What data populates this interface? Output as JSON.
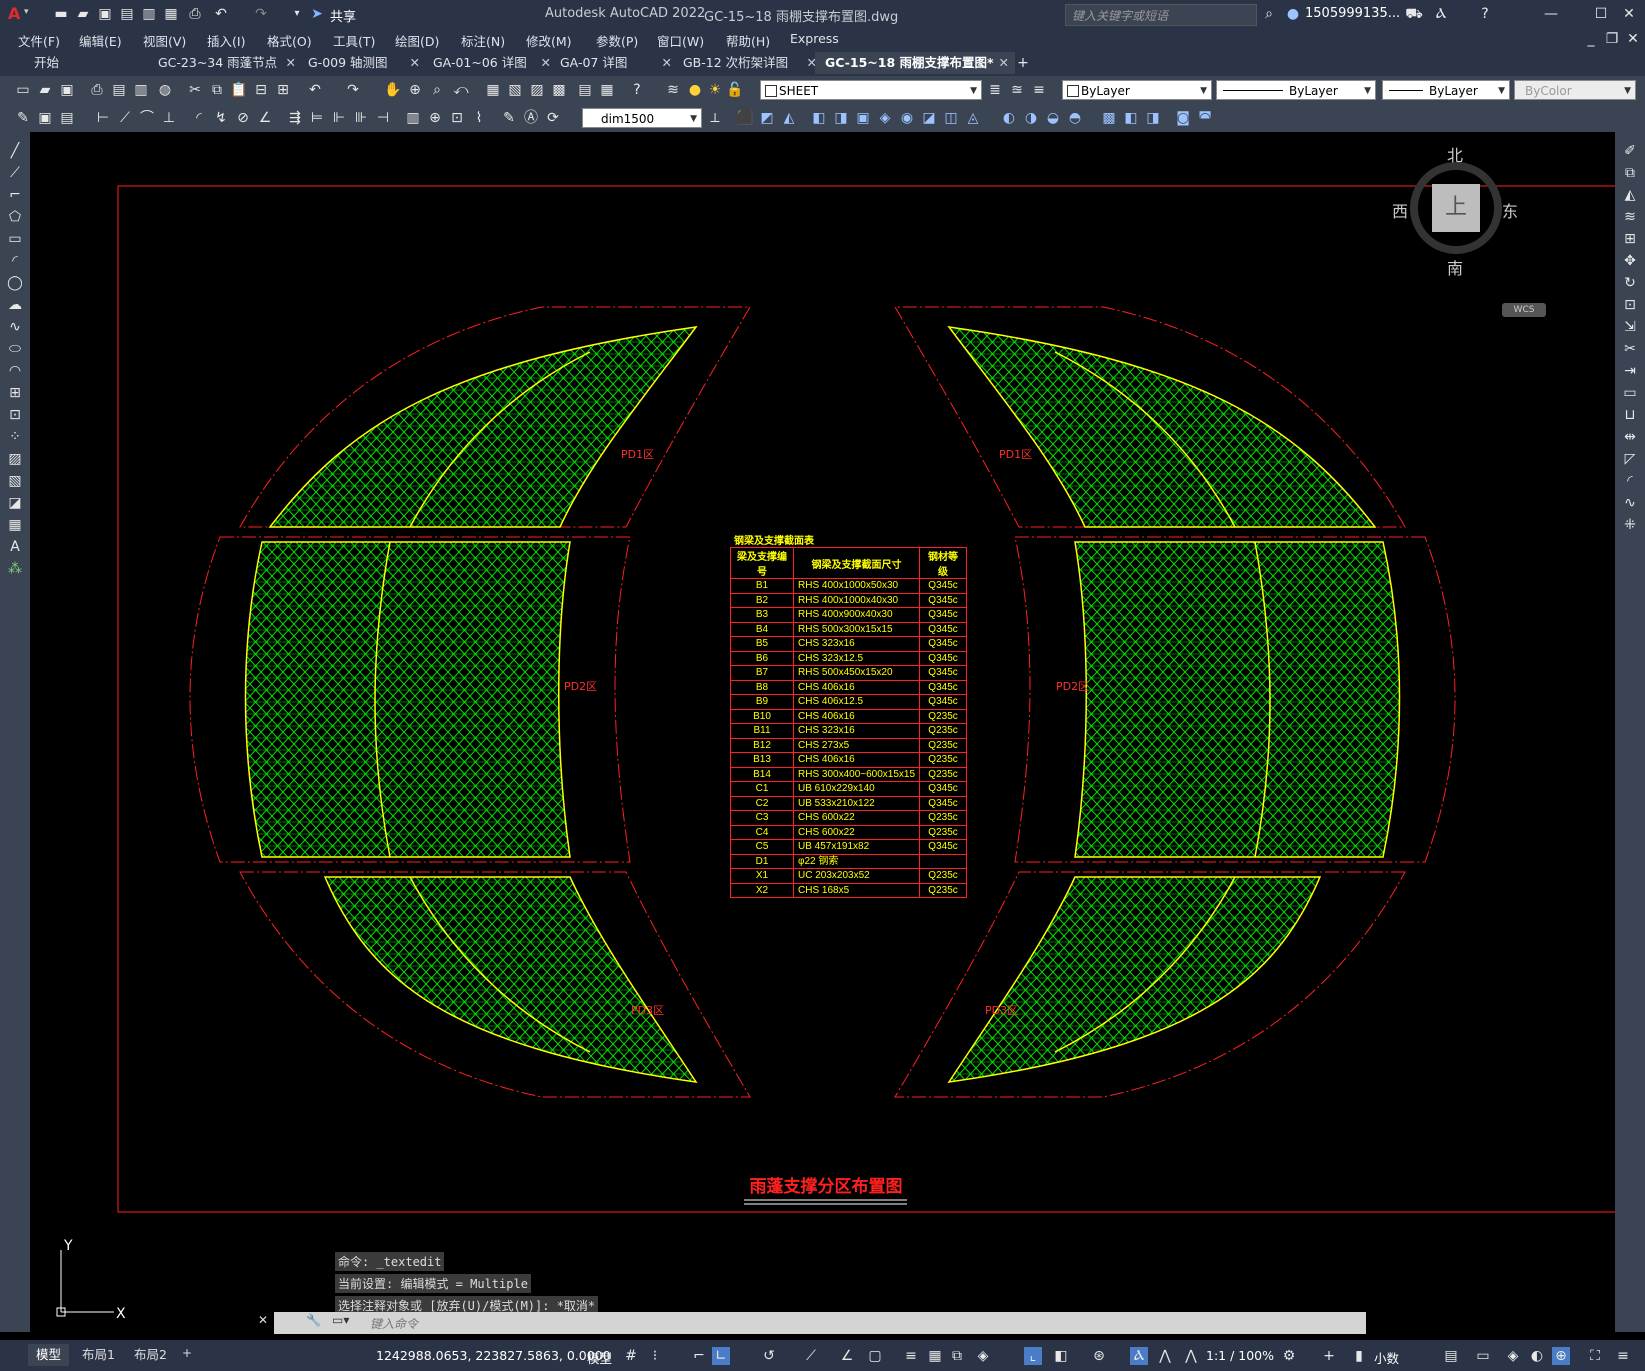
{
  "titlebar": {
    "app_title": "Autodesk AutoCAD 2022",
    "doc_title": "GC-15~18 雨棚支撑布置图.dwg",
    "share_label": "共享",
    "search_placeholder": "键入关键字或短语",
    "user": "1505999135..."
  },
  "menu": [
    "文件(F)",
    "编辑(E)",
    "视图(V)",
    "插入(I)",
    "格式(O)",
    "工具(T)",
    "绘图(D)",
    "标注(N)",
    "修改(M)",
    "参数(P)",
    "窗口(W)",
    "帮助(H)",
    "Express"
  ],
  "tabs": [
    {
      "label": "开始",
      "closable": false
    },
    {
      "label": "GC-23~34 雨蓬节点",
      "closable": true
    },
    {
      "label": "G-009 轴测图",
      "closable": true
    },
    {
      "label": "GA-01~06 详图",
      "closable": true
    },
    {
      "label": "GA-07 详图",
      "closable": true
    },
    {
      "label": "GB-12 次桁架详图",
      "closable": true
    },
    {
      "label": "GC-15~18 雨棚支撑布置图*",
      "closable": true,
      "active": true
    }
  ],
  "properties": {
    "layer": "SHEET",
    "color": "ByLayer",
    "linetype": "ByLayer",
    "lineweight": "ByLayer",
    "plotstyle": "ByColor",
    "dimstyle": "dim1500"
  },
  "viewcube": {
    "north": "北",
    "south": "南",
    "east": "东",
    "west": "西",
    "top": "上",
    "wcs": "WCS"
  },
  "drawing": {
    "title": "雨蓬支撑分区布置图",
    "zone_labels": [
      "PD1区",
      "PD2区",
      "PD3区",
      "PD1区",
      "PD2区",
      "PD3区"
    ],
    "colors": {
      "border": "#ff0000",
      "truss": "#00ff00",
      "chord": "#ffff00"
    }
  },
  "bom": {
    "title": "钢梁及支撑截面表",
    "headers": [
      "梁及支撑编号",
      "钢梁及支撑截面尺寸",
      "钢材等级"
    ],
    "rows": [
      [
        "B1",
        "RHS 400x1000x50x30",
        "Q345c"
      ],
      [
        "B2",
        "RHS 400x1000x40x30",
        "Q345c"
      ],
      [
        "B3",
        "RHS 400x900x40x30",
        "Q345c"
      ],
      [
        "B4",
        "RHS 500x300x15x15",
        "Q345c"
      ],
      [
        "B5",
        "CHS 323x16",
        "Q345c"
      ],
      [
        "B6",
        "CHS 323x12.5",
        "Q345c"
      ],
      [
        "B7",
        "RHS 500x450x15x20",
        "Q345c"
      ],
      [
        "B8",
        "CHS 406x16",
        "Q345c"
      ],
      [
        "B9",
        "CHS 406x12.5",
        "Q345c"
      ],
      [
        "B10",
        "CHS 406x16",
        "Q235c"
      ],
      [
        "B11",
        "CHS 323x16",
        "Q235c"
      ],
      [
        "B12",
        "CHS 273x5",
        "Q235c"
      ],
      [
        "B13",
        "CHS 406x16",
        "Q235c"
      ],
      [
        "B14",
        "RHS 300x400~600x15x15",
        "Q235c"
      ],
      [
        "C1",
        "UB 610x229x140",
        "Q345c"
      ],
      [
        "C2",
        "UB 533x210x122",
        "Q345c"
      ],
      [
        "C3",
        "CHS 600x22",
        "Q235c"
      ],
      [
        "C4",
        "CHS 600x22",
        "Q235c"
      ],
      [
        "C5",
        "UB 457x191x82",
        "Q345c"
      ],
      [
        "D1",
        "φ22 钢索",
        ""
      ],
      [
        "X1",
        "UC 203x203x52",
        "Q235c"
      ],
      [
        "X2",
        "CHS 168x5",
        "Q235c"
      ]
    ]
  },
  "command": {
    "history": [
      "命令: _textedit",
      "当前设置: 编辑模式 = Multiple",
      "选择注释对象或 [放弃(U)/模式(M)]: *取消*"
    ],
    "placeholder": "键入命令"
  },
  "status": {
    "layout_tabs": [
      "模型",
      "布局1",
      "布局2"
    ],
    "coords": "1242988.0653, 223827.5863, 0.0000",
    "mode": "模型",
    "scale": "1:1 / 100%",
    "units": "小数"
  },
  "ucs": {
    "y": "Y",
    "x": "X"
  }
}
